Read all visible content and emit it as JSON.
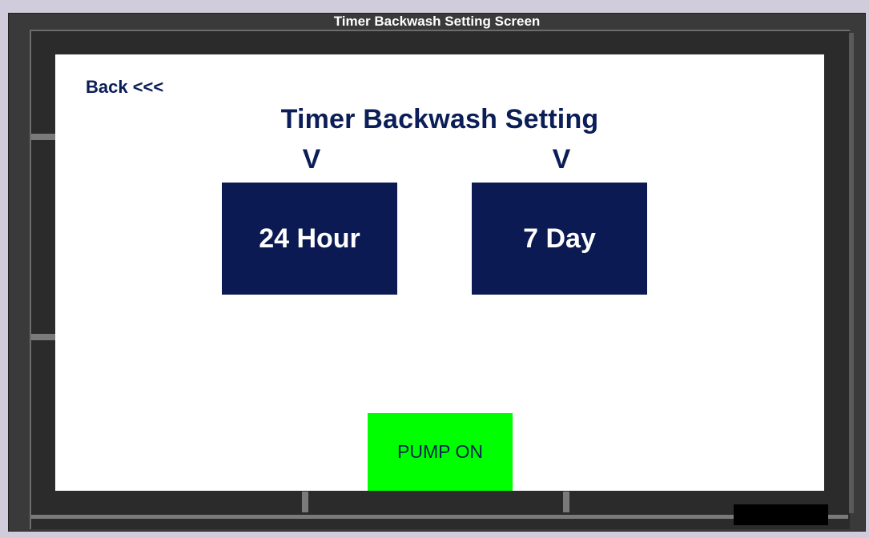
{
  "window": {
    "title": "Timer Backwash Setting Screen"
  },
  "screen": {
    "back_label": "Back <<<",
    "heading": "Timer Backwash Setting",
    "modes": [
      {
        "indicator": "V",
        "label": "24 Hour"
      },
      {
        "indicator": "V",
        "label": "7 Day"
      }
    ],
    "pump_button": "PUMP ON"
  },
  "colors": {
    "navy": "#0b1a52",
    "pump_green": "#00ff00",
    "frame": "#3a3a3a",
    "background": "#d0ccdc"
  }
}
